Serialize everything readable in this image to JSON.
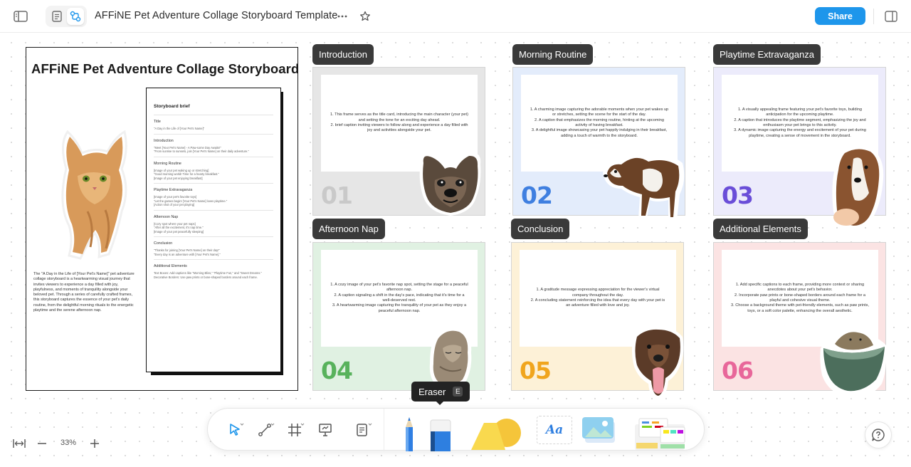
{
  "header": {
    "title": "AFFiNE Pet Adventure Collage Storyboard Template",
    "share_label": "Share",
    "icons": [
      "sidebar-toggle-icon",
      "page-mode-icon",
      "edgeless-mode-icon",
      "more-icon",
      "star-icon",
      "right-panel-icon"
    ]
  },
  "brief": {
    "title": "AFFiNE Pet Adventure Collage Storyboard",
    "description": "The \"A Day in the Life of [Your Pet's Name]\" pet adventure collage storyboard is a heartwarming visual journey that invites viewers to experience a day filled with joy, playfulness, and moments of tranquility alongside your beloved pet. Through a series of carefully crafted frames, this storyboard captures the essence of your pet's daily routine, from the delightful morning rituals to the energetic playtime and the serene afternoon nap.",
    "card": {
      "heading": "Storyboard brief",
      "sections": [
        {
          "title": "Title",
          "lines": [
            "\"A Day in the Life of [Your Pet's Name]\""
          ]
        },
        {
          "title": "Introduction",
          "lines": [
            "\"Meet [Your Pet's Name] - A Paw-some Day Awaits!\"",
            "\"From sunrise to sunsets, join [Your Pet's Name] on their daily adventure.\""
          ]
        },
        {
          "title": "Morning Routine",
          "lines": [
            "[Image of your pet waking up or stretching]",
            "\"Good morning world! Time for a hearty breakfast.\"",
            "[Image of your pet enjoying breakfast]"
          ]
        },
        {
          "title": "Playtime Extravaganza",
          "lines": [
            "[Image of your pet's favorite toys]",
            "\"Let the games begin! [Your Pet's Name] loves playtime.\"",
            "[Action shot of your pet playing]"
          ]
        },
        {
          "title": "Afternoon Nap",
          "lines": [
            "[Cozy spot where your pet naps]",
            "\"After all the excitement, it's nap time.\"",
            "[Image of your pet peacefully sleeping]"
          ]
        },
        {
          "title": "Conclusion",
          "lines": [
            "\"Thanks for joining [Your Pet's Name] on their day!\"",
            "\"Every day is an adventure with [Your Pet's Name].\""
          ]
        },
        {
          "title": "Additional Elements",
          "lines": [
            "Text Boxes: Add captions like \"Morning Bliss,\" \"Playtime Fun,\" and \"Sweet Dreams.\"",
            "Decorative Borders: Use paw prints or bone-shaped borders around each frame."
          ]
        }
      ]
    }
  },
  "frames": [
    {
      "label": "Introduction",
      "number": "01",
      "bg": "#e6e6e6",
      "numColor": "#c9c9c9",
      "lines": [
        "1. This frame serves as the title card, introducing the main character (your pet) and setting the tone for an exciting day ahead.",
        "2.  brief caption inviting viewers to follow along and experience a day filled with joy and activities alongside your pet."
      ]
    },
    {
      "label": "Morning Routine",
      "number": "02",
      "bg": "#e3ecfb",
      "numColor": "#3f7fe0",
      "lines": [
        "1. A charming image capturing the adorable moments when your pet wakes up or stretches, setting the scene for the start of the day.",
        "2. A caption that emphasizes the morning routine, hinting at the upcoming activity of having breakfast.",
        "3. A delightful image showcasing your pet happily indulging in their breakfast, adding a touch of warmth to the storyboard."
      ]
    },
    {
      "label": "Playtime Extravaganza",
      "number": "03",
      "bg": "#ecebfb",
      "numColor": "#6a4ed8",
      "lines": [
        "1. A visually appealing frame featuring your pet's favorite toys, building anticipation for the upcoming playtime.",
        "2. A caption that introduces the playtime segment, emphasizing the joy and enthusiasm your pet brings to this activity.",
        "3. A dynamic image capturing the energy and excitement of your pet during playtime, creating a sense of movement in the storyboard."
      ]
    },
    {
      "label": "Afternoon Nap",
      "number": "04",
      "bg": "#e0f1e2",
      "numColor": "#58b25c",
      "lines": [
        "1. A cozy image of your pet's favorite nap spot, setting the stage for a peaceful afternoon nap.",
        "2. A caption signaling a shift in the day's pace, indicating that it's time for a well-deserved rest.",
        "3. A heartwarming image capturing the tranquility of your pet as they enjoy a peaceful afternoon nap."
      ]
    },
    {
      "label": "Conclusion",
      "number": "05",
      "bg": "#fdf1d7",
      "numColor": "#f0a51e",
      "lines": [
        "1. A gratitude message expressing appreciation for the viewer's virtual company throughout the day.",
        "2. A concluding statement reinforcing the idea that every day with your pet is an adventure filled with love and joy."
      ]
    },
    {
      "label": "Additional Elements",
      "number": "06",
      "bg": "#fbe3e3",
      "numColor": "#e8679a",
      "lines": [
        "1. Add specific captions to each frame, providing more context or sharing anecdotes about your pet's behavior.",
        "2. Incorporate paw prints or bone-shaped borders around each frame for a playful and cohesive visual theme.",
        "3. Choose a background theme with pet-friendly elements, such as paw prints, toys, or a soft color palette, enhancing the overall aesthetic."
      ]
    }
  ],
  "tooltip": {
    "label": "Eraser",
    "shortcut": "E"
  },
  "toolbar": {
    "tools": [
      "select",
      "connector",
      "frame",
      "presentation",
      "note",
      "pen",
      "eraser",
      "shape",
      "text",
      "image",
      "template"
    ],
    "text_tool_label": "Aa"
  },
  "zoom": {
    "level": "33%"
  },
  "colors": {
    "accent": "#1e96eb",
    "label_bg": "#3a3a3a"
  }
}
